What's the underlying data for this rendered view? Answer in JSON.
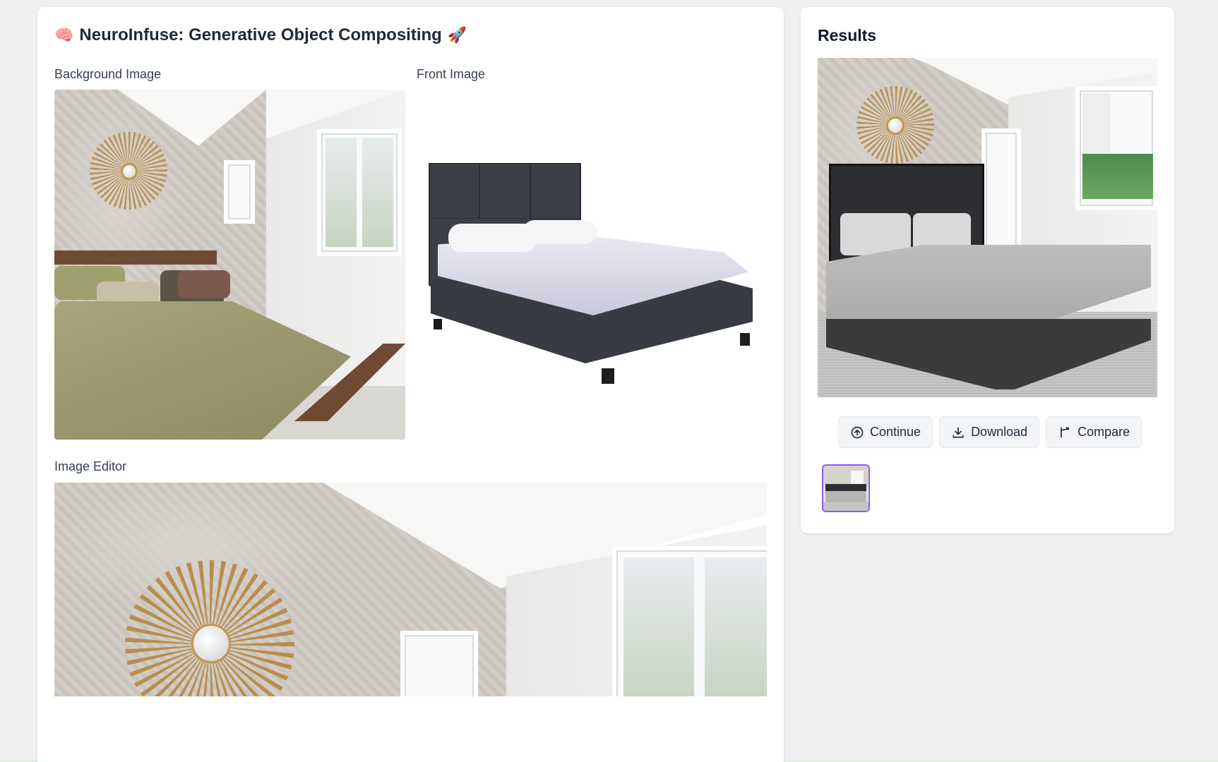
{
  "app": {
    "title": "NeuroInfuse: Generative Object Compositing",
    "title_emoji_left": "🧠",
    "title_emoji_right": "🚀"
  },
  "inputs": {
    "background_label": "Background Image",
    "front_label": "Front Image",
    "editor_label": "Image Editor"
  },
  "results": {
    "title": "Results",
    "buttons": {
      "continue": "Continue",
      "download": "Download",
      "compare": "Compare"
    }
  },
  "colors": {
    "page_bg": "#eff0f2",
    "card_bg": "#ffffff",
    "thumb_border": "#8b5cf6"
  }
}
